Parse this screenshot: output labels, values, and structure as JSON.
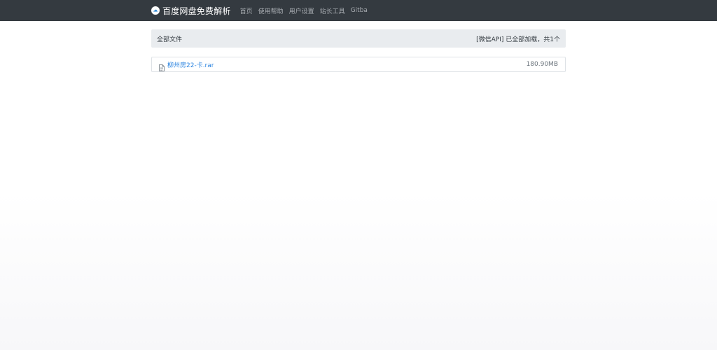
{
  "navbar": {
    "brand": "百度网盘免费解析",
    "links": [
      "首页",
      "使用帮助",
      "用户设置",
      "站长工具",
      "Gitba"
    ],
    "background_color": "#343a40",
    "icon": "cloud-icon"
  },
  "panel": {
    "title": "全部文件",
    "status": "[微信API] 已全部加载，共1个"
  },
  "files": [
    {
      "name": "柳州房22-卡.rar",
      "size": "180.90MB",
      "icon": "file-icon",
      "link_color": "#2f86e0"
    }
  ]
}
